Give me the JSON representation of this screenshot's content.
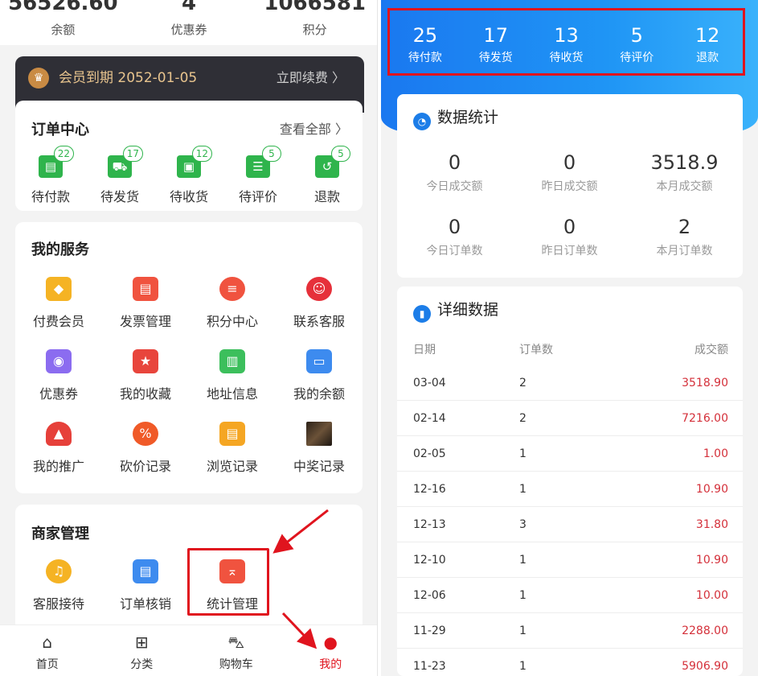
{
  "left": {
    "stats": [
      {
        "value": "56526.60",
        "label": "余额"
      },
      {
        "value": "4",
        "label": "优惠券"
      },
      {
        "value": "1066581",
        "label": "积分"
      }
    ],
    "member": {
      "text": "会员到期 2052-01-05",
      "action": "立即续费 〉",
      "icon": "crown-icon"
    },
    "orders": {
      "title": "订单中心",
      "view_all": "查看全部 〉",
      "items": [
        {
          "label": "待付款",
          "count": "22",
          "icon": "wallet-icon"
        },
        {
          "label": "待发货",
          "count": "17",
          "icon": "truck-icon"
        },
        {
          "label": "待收货",
          "count": "12",
          "icon": "package-icon"
        },
        {
          "label": "待评价",
          "count": "5",
          "icon": "comment-icon"
        },
        {
          "label": "退款",
          "count": "5",
          "icon": "refund-icon"
        }
      ]
    },
    "services": {
      "title": "我的服务",
      "items": [
        {
          "label": "付费会员",
          "icon": "diamond-icon",
          "color": "#f5b324"
        },
        {
          "label": "发票管理",
          "icon": "invoice-icon",
          "color": "#f0533f"
        },
        {
          "label": "积分中心",
          "icon": "coins-icon",
          "color": "#f0533f"
        },
        {
          "label": "联系客服",
          "icon": "service-icon",
          "color": "#e6303a"
        },
        {
          "label": "优惠券",
          "icon": "coupon-icon",
          "color": "#8b6cf0"
        },
        {
          "label": "我的收藏",
          "icon": "star-icon",
          "color": "#e8453c"
        },
        {
          "label": "地址信息",
          "icon": "address-icon",
          "color": "#3cbf5c"
        },
        {
          "label": "我的余额",
          "icon": "balance-icon",
          "color": "#3d8bef"
        },
        {
          "label": "我的推广",
          "icon": "rocket-icon",
          "color": "#e6403a"
        },
        {
          "label": "砍价记录",
          "icon": "discount-icon",
          "color": "#f05a28"
        },
        {
          "label": "浏览记录",
          "icon": "history-icon",
          "color": "#f5a623"
        },
        {
          "label": "中奖记录",
          "icon": "prize-photo-icon",
          "color": "#4a3a2c"
        }
      ]
    },
    "merchant": {
      "title": "商家管理",
      "items": [
        {
          "label": "客服接待",
          "icon": "headset-icon",
          "color": "#f5b324"
        },
        {
          "label": "订单核销",
          "icon": "verify-icon",
          "color": "#3d8bef"
        },
        {
          "label": "统计管理",
          "icon": "statistics-icon",
          "color": "#f0533f"
        }
      ]
    },
    "tabbar": [
      {
        "label": "首页",
        "icon": "home-icon"
      },
      {
        "label": "分类",
        "icon": "grid-icon"
      },
      {
        "label": "购物车",
        "icon": "cart-icon"
      },
      {
        "label": "我的",
        "icon": "user-icon"
      }
    ]
  },
  "right": {
    "order_stats": [
      {
        "value": "25",
        "label": "待付款"
      },
      {
        "value": "17",
        "label": "待发货"
      },
      {
        "value": "13",
        "label": "待收货"
      },
      {
        "value": "5",
        "label": "待评价"
      },
      {
        "value": "12",
        "label": "退款"
      }
    ],
    "stats_card": {
      "title": "数据统计",
      "items": [
        {
          "value": "0",
          "label": "今日成交额"
        },
        {
          "value": "0",
          "label": "昨日成交额"
        },
        {
          "value": "3518.9",
          "label": "本月成交额"
        },
        {
          "value": "0",
          "label": "今日订单数"
        },
        {
          "value": "0",
          "label": "昨日订单数"
        },
        {
          "value": "2",
          "label": "本月订单数"
        }
      ]
    },
    "detail_card": {
      "title": "详细数据",
      "columns": [
        "日期",
        "订单数",
        "成交额"
      ],
      "rows": [
        [
          "03-04",
          "2",
          "3518.90"
        ],
        [
          "02-14",
          "2",
          "7216.00"
        ],
        [
          "02-05",
          "1",
          "1.00"
        ],
        [
          "12-16",
          "1",
          "10.90"
        ],
        [
          "12-13",
          "3",
          "31.80"
        ],
        [
          "12-10",
          "1",
          "10.90"
        ],
        [
          "12-06",
          "1",
          "10.00"
        ],
        [
          "11-29",
          "1",
          "2288.00"
        ],
        [
          "11-23",
          "1",
          "5906.90"
        ]
      ]
    }
  }
}
